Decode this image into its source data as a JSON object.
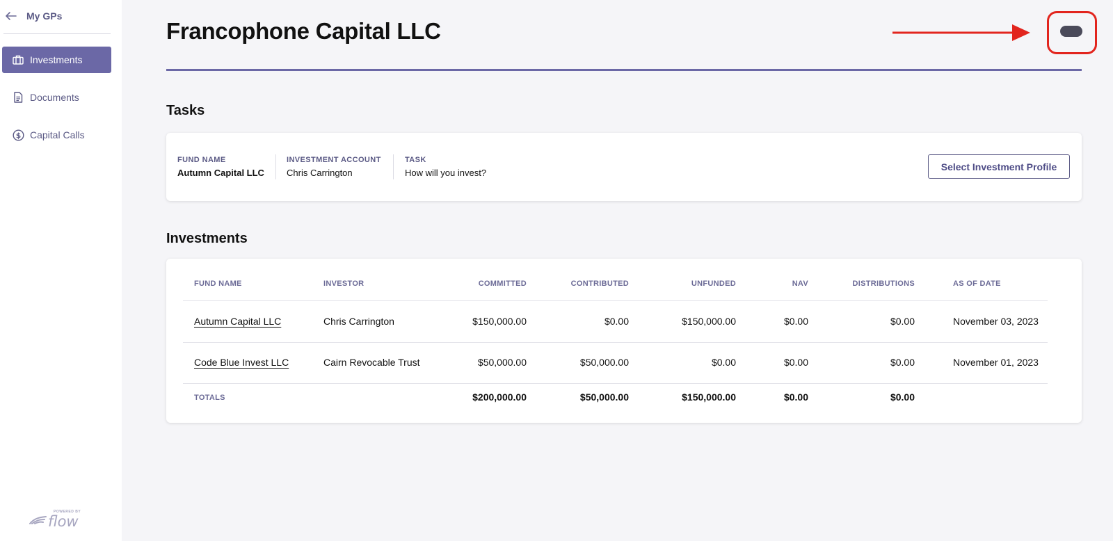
{
  "sidebar": {
    "back_label": "My GPs",
    "items": [
      {
        "label": "Investments",
        "icon": "briefcase-icon",
        "active": true
      },
      {
        "label": "Documents",
        "icon": "document-icon",
        "active": false
      },
      {
        "label": "Capital Calls",
        "icon": "dollar-circle-icon",
        "active": false
      }
    ],
    "powered_by": "POWERED BY",
    "brand": "flow"
  },
  "header": {
    "title": "Francophone Capital LLC"
  },
  "colors": {
    "accent": "#6b68a6",
    "annotation": "#e2251e"
  },
  "tasks": {
    "section_title": "Tasks",
    "fund_name_label": "FUND NAME",
    "fund_name": "Autumn Capital LLC",
    "account_label": "INVESTMENT ACCOUNT",
    "account": "Chris Carrington",
    "task_label": "TASK",
    "task": "How will you invest?",
    "button_label": "Select Investment Profile"
  },
  "investments": {
    "section_title": "Investments",
    "columns": [
      "FUND NAME",
      "INVESTOR",
      "COMMITTED",
      "CONTRIBUTED",
      "UNFUNDED",
      "NAV",
      "DISTRIBUTIONS",
      "AS OF DATE"
    ],
    "rows": [
      [
        "Autumn Capital LLC",
        "Chris Carrington",
        "$150,000.00",
        "$0.00",
        "$150,000.00",
        "$0.00",
        "$0.00",
        "November 03, 2023"
      ],
      [
        "Code Blue Invest LLC",
        "Cairn Revocable Trust",
        "$50,000.00",
        "$50,000.00",
        "$0.00",
        "$0.00",
        "$0.00",
        "November 01, 2023"
      ]
    ],
    "totals": {
      "label": "TOTALS",
      "committed": "$200,000.00",
      "contributed": "$50,000.00",
      "unfunded": "$150,000.00",
      "nav": "$0.00",
      "distributions": "$0.00"
    }
  }
}
